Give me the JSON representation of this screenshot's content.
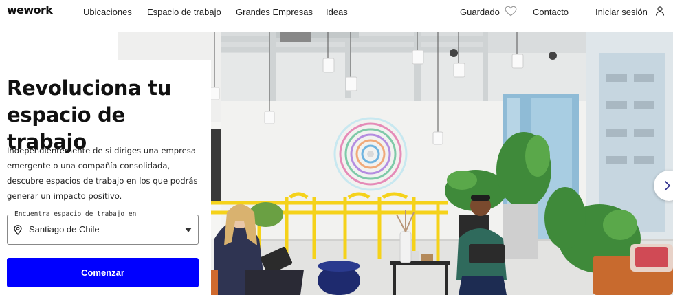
{
  "brand": {
    "logo": "wework"
  },
  "nav": {
    "ubicaciones": "Ubicaciones",
    "espacio": "Espacio de trabajo",
    "grandes": "Grandes Empresas",
    "ideas": "Ideas",
    "guardado": "Guardado",
    "contacto": "Contacto",
    "login": "Iniciar sesión"
  },
  "hero": {
    "title": "Revoluciona tu espacio de trabajo",
    "description": "Independientemente de si diriges una empresa emergente o una compañía consolidada, descubre espacios de trabajo en los que podrás generar un impacto positivo.",
    "search": {
      "legend": "Encuentra espacio de trabajo en",
      "value": "Santiago de Chile"
    },
    "cta": "Comenzar"
  },
  "icons": {
    "heart": "heart-outline-icon",
    "user": "user-icon",
    "pin": "map-pin-icon",
    "caret": "caret-down-icon",
    "next": "chevron-right-icon"
  },
  "colors": {
    "cta_blue": "#0000ff",
    "text": "#111111",
    "railing_yellow": "#f5d21a"
  }
}
